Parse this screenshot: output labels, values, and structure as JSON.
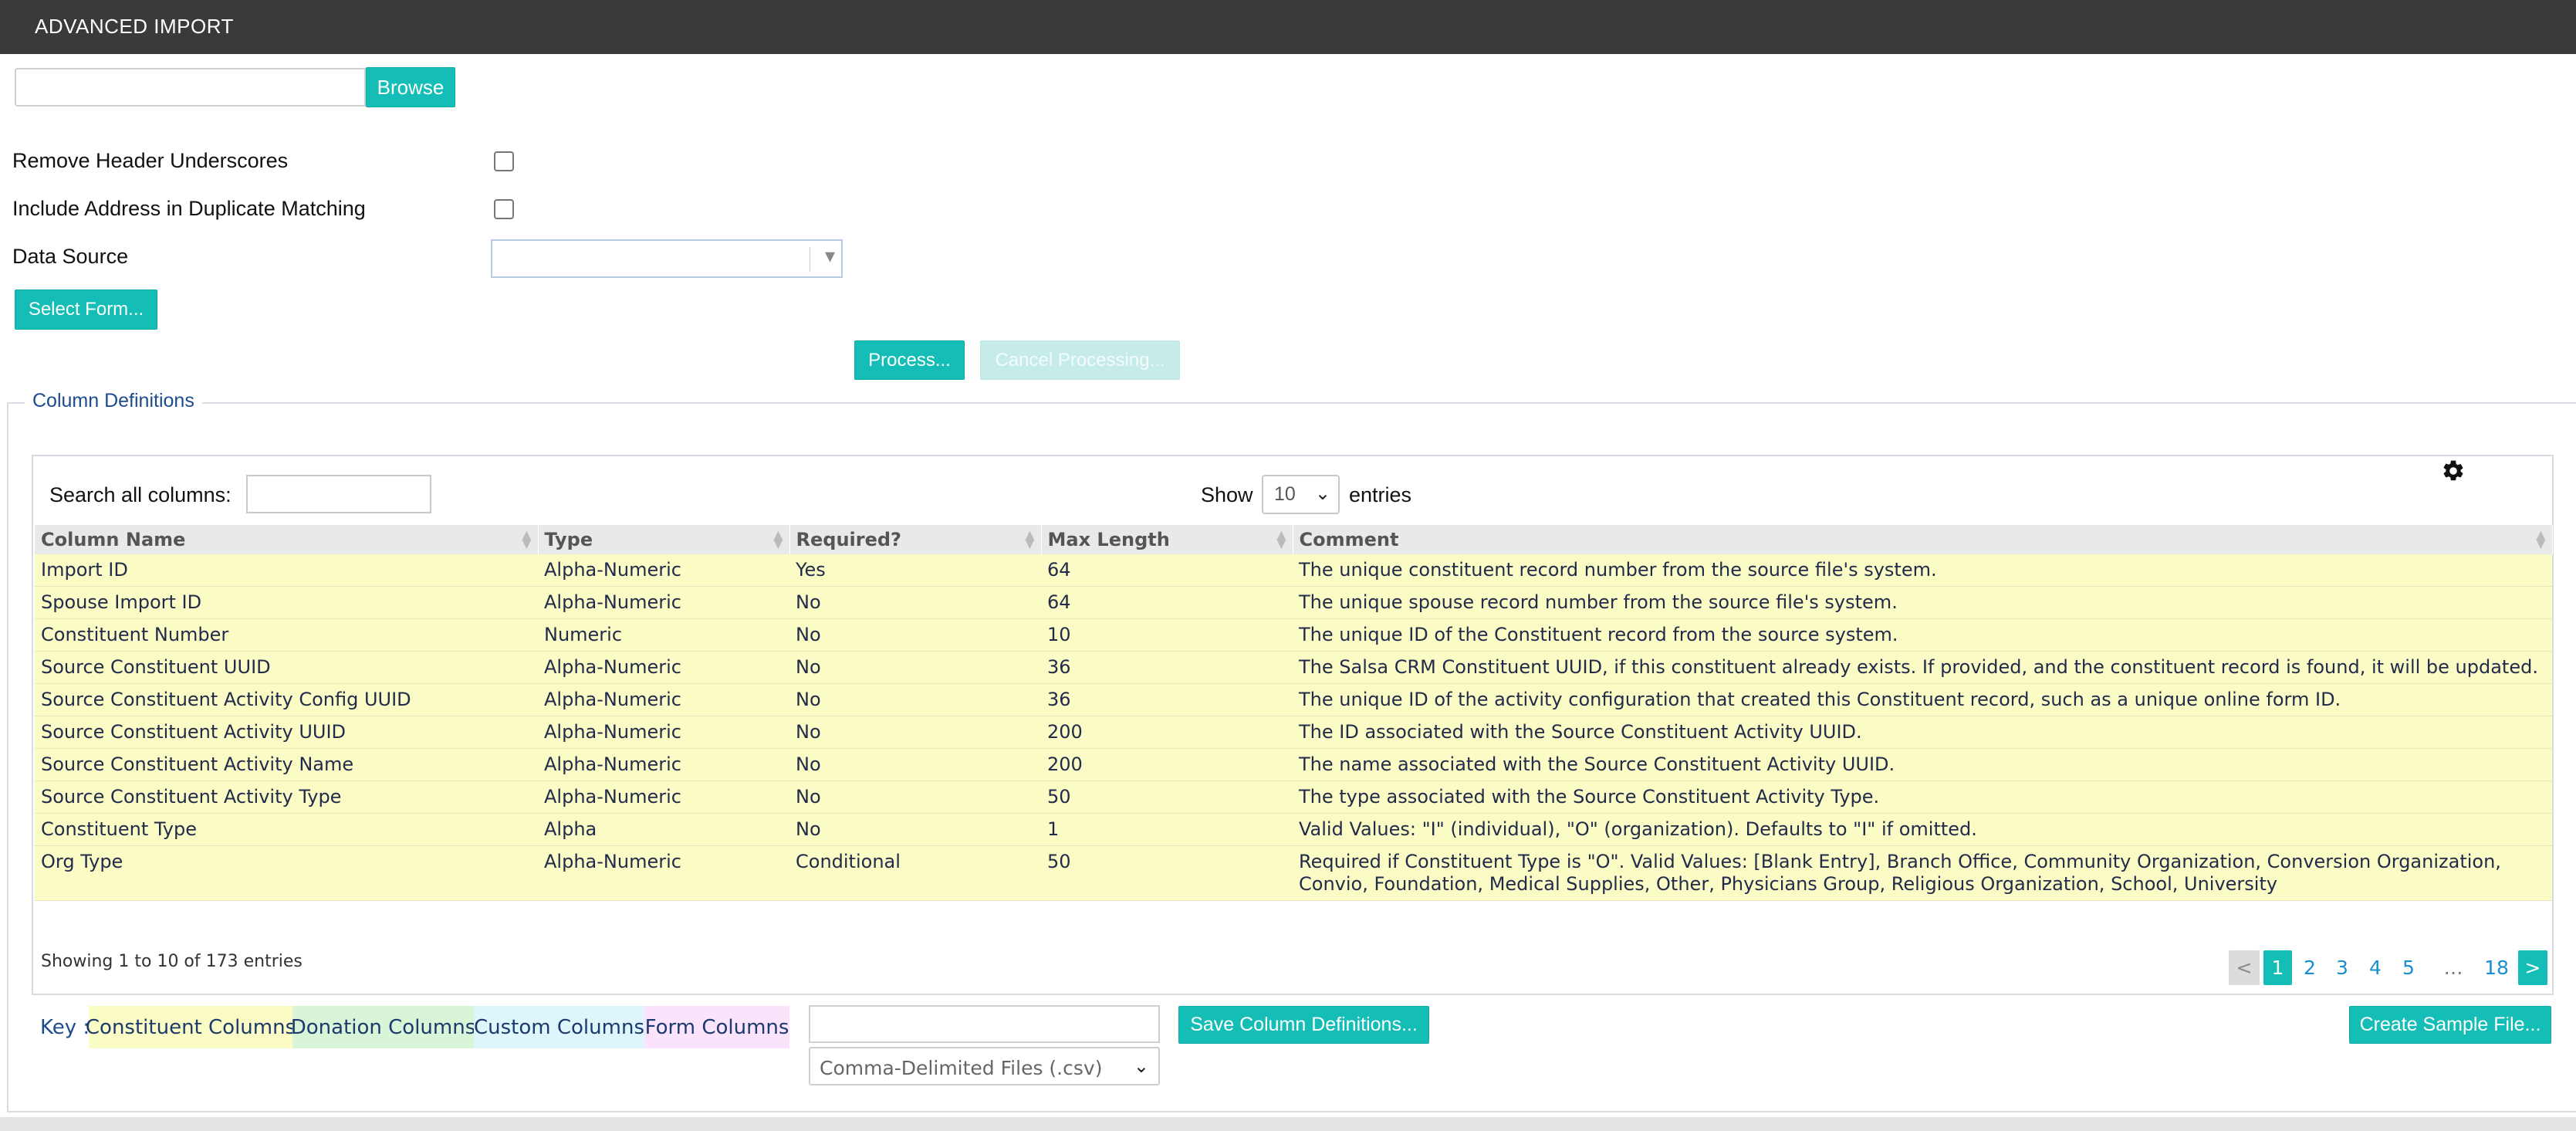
{
  "window": {
    "title": "ADVANCED IMPORT"
  },
  "file_picker": {
    "value": "",
    "browse_label": "Browse"
  },
  "options": {
    "remove_header_underscores": {
      "label": "Remove Header Underscores",
      "checked": false
    },
    "include_address": {
      "label": "Include Address in Duplicate Matching",
      "checked": false
    },
    "data_source": {
      "label": "Data Source",
      "value": ""
    }
  },
  "buttons": {
    "select_form": "Select Form...",
    "process": "Process...",
    "cancel_processing": "Cancel Processing...",
    "save_column_definitions": "Save Column Definitions...",
    "create_sample_file": "Create Sample File..."
  },
  "column_definitions": {
    "legend": "Column Definitions",
    "search_label": "Search all columns:",
    "search_value": "",
    "show_label": "Show",
    "entries_value": "10",
    "entries_label": "entries",
    "settings_icon": "gear-icon",
    "headers": [
      "Column Name",
      "Type",
      "Required?",
      "Max Length",
      "Comment"
    ],
    "rows": [
      [
        "Import ID",
        "Alpha-Numeric",
        "Yes",
        "64",
        "The unique constituent record number from the source file's system."
      ],
      [
        "Spouse Import ID",
        "Alpha-Numeric",
        "No",
        "64",
        "The unique spouse record number from the source file's system."
      ],
      [
        "Constituent Number",
        "Numeric",
        "No",
        "10",
        "The unique ID of the Constituent record from the source system."
      ],
      [
        "Source Constituent UUID",
        "Alpha-Numeric",
        "No",
        "36",
        "The Salsa CRM Constituent UUID, if this constituent already exists. If provided, and the constituent record is found, it will be updated."
      ],
      [
        "Source Constituent Activity Config UUID",
        "Alpha-Numeric",
        "No",
        "36",
        "The unique ID of the activity configuration that created this Constituent record, such as a unique online form ID."
      ],
      [
        "Source Constituent Activity UUID",
        "Alpha-Numeric",
        "No",
        "200",
        "The ID associated with the Source Constituent Activity UUID."
      ],
      [
        "Source Constituent Activity Name",
        "Alpha-Numeric",
        "No",
        "200",
        "The name associated with the Source Constituent Activity UUID."
      ],
      [
        "Source Constituent Activity Type",
        "Alpha-Numeric",
        "No",
        "50",
        "The type associated with the Source Constituent Activity Type."
      ],
      [
        "Constituent Type",
        "Alpha",
        "No",
        "1",
        "Valid Values: \"I\" (individual), \"O\" (organization). Defaults to \"I\" if omitted."
      ],
      [
        "Org Type",
        "Alpha-Numeric",
        "Conditional",
        "50",
        "Required if Constituent Type is \"O\". Valid Values: [Blank Entry], Branch Office, Community Organization, Conversion Organization, Convio, Foundation, Medical Supplies, Other, Physicians Group, Religious Organization, School, University"
      ]
    ],
    "info": "Showing 1 to 10 of 173 entries",
    "pagination": {
      "prev": "<",
      "current": "1",
      "pages": [
        "2",
        "3",
        "4",
        "5"
      ],
      "ellipsis": "…",
      "last": "18",
      "next": ">"
    }
  },
  "key": {
    "label": "Key :",
    "items": [
      {
        "label": "Constituent Columns",
        "color": "#fbfbc5"
      },
      {
        "label": "Donation Columns",
        "color": "#d8f5d8"
      },
      {
        "label": "Custom Columns",
        "color": "#ddf6fb"
      },
      {
        "label": "Form Columns",
        "color": "#fbe3fb"
      }
    ]
  },
  "export": {
    "filename": "",
    "file_type": "Comma-Delimited Files (.csv)"
  },
  "colors": {
    "accent": "#14bdb5",
    "titlebar": "#3a3a3a",
    "link": "#1c4b8f"
  }
}
